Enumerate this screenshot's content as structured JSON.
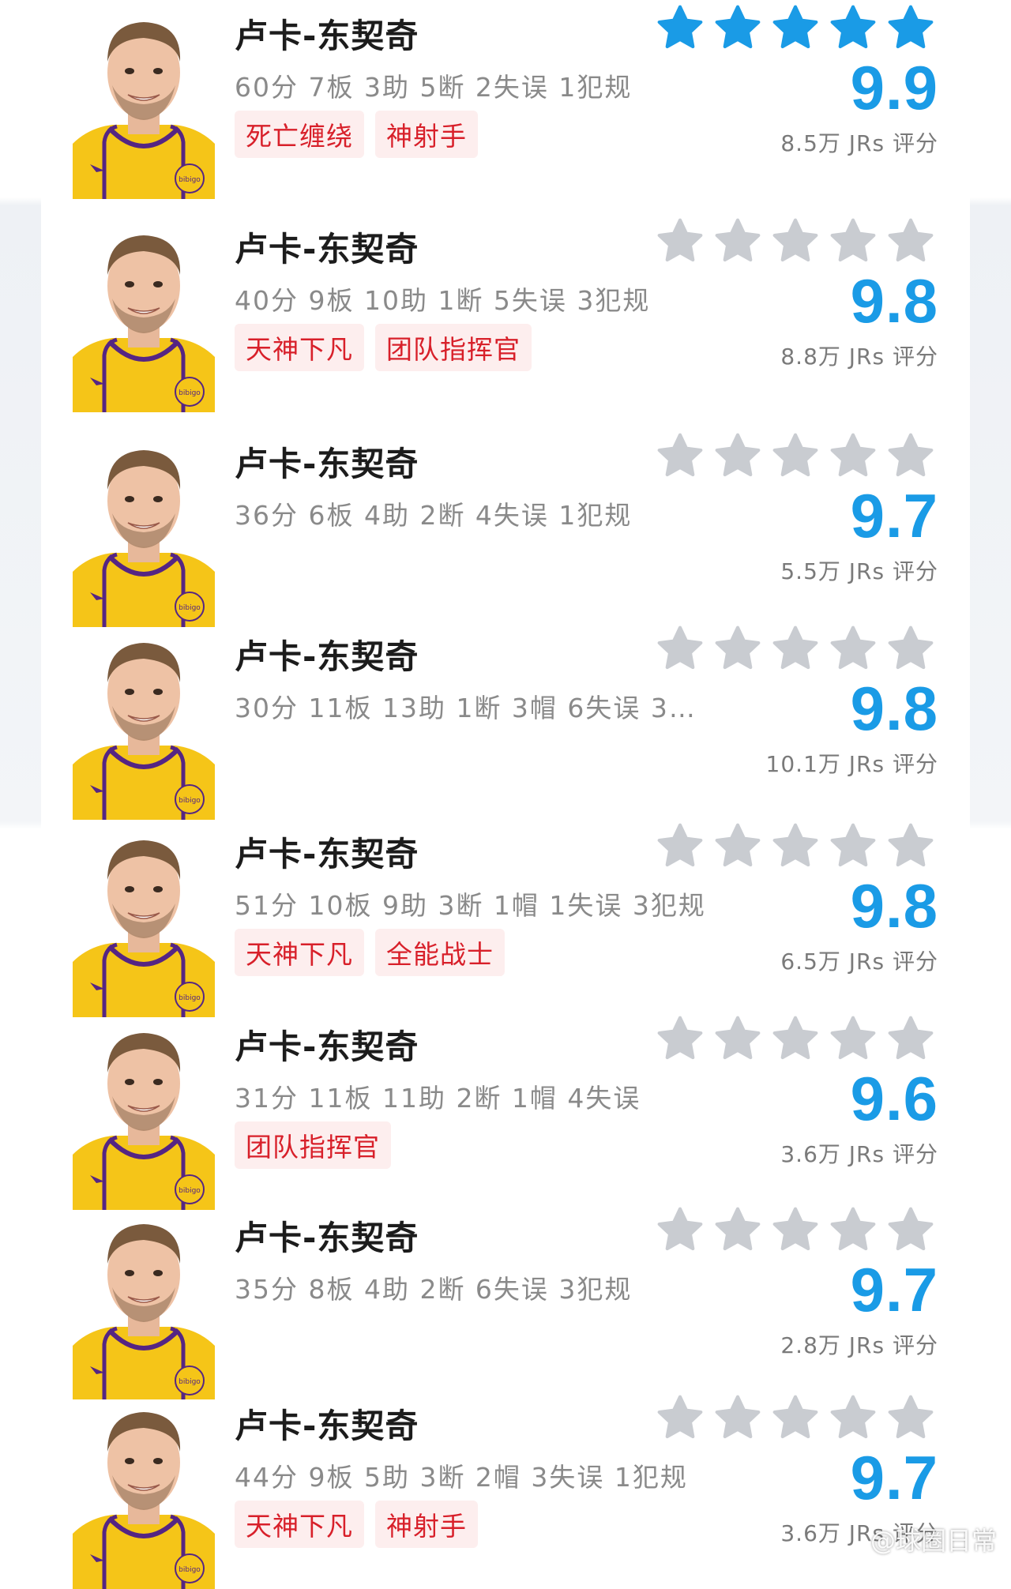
{
  "colors": {
    "score_blue": "#1a9be6",
    "star_active": "#1a9be6",
    "star_inactive": "#c9ccd1",
    "tag_text": "#d8202a",
    "tag_bg": "#fdeeee"
  },
  "items": [
    {
      "name": "卢卡-东契奇",
      "stats": "60分 7板 3助 5断 2失误 1犯规",
      "tags": [
        "死亡缠绕",
        "神射手"
      ],
      "stars_active": true,
      "score": "9.9",
      "count": "8.5万 JRs 评分"
    },
    {
      "name": "卢卡-东契奇",
      "stats": "40分 9板 10助 1断 5失误 3犯规",
      "tags": [
        "天神下凡",
        "团队指挥官"
      ],
      "stars_active": false,
      "score": "9.8",
      "count": "8.8万 JRs 评分"
    },
    {
      "name": "卢卡-东契奇",
      "stats": "36分 6板 4助 2断 4失误 1犯规",
      "tags": [],
      "stars_active": false,
      "score": "9.7",
      "count": "5.5万 JRs 评分"
    },
    {
      "name": "卢卡-东契奇",
      "stats": "30分 11板 13助 1断 3帽 6失误 3…",
      "tags": [],
      "stars_active": false,
      "score": "9.8",
      "count": "10.1万 JRs 评分"
    },
    {
      "name": "卢卡-东契奇",
      "stats": "51分 10板 9助 3断 1帽 1失误 3犯规",
      "tags": [
        "天神下凡",
        "全能战士"
      ],
      "stars_active": false,
      "score": "9.8",
      "count": "6.5万 JRs 评分"
    },
    {
      "name": "卢卡-东契奇",
      "stats": "31分 11板 11助 2断 1帽 4失误",
      "tags": [
        "团队指挥官"
      ],
      "stars_active": false,
      "score": "9.6",
      "count": "3.6万 JRs 评分"
    },
    {
      "name": "卢卡-东契奇",
      "stats": "35分 8板 4助 2断 6失误 3犯规",
      "tags": [],
      "stars_active": false,
      "score": "9.7",
      "count": "2.8万 JRs 评分"
    },
    {
      "name": "卢卡-东契奇",
      "stats": "44分 9板 5助 3断 2帽 3失误 1犯规",
      "tags": [
        "天神下凡",
        "神射手"
      ],
      "stars_active": false,
      "score": "9.7",
      "count": "3.6万 JRs 评分"
    }
  ],
  "watermark": "@球圈日常",
  "icons": {
    "avatar": "player-avatar",
    "star": "star-icon"
  }
}
